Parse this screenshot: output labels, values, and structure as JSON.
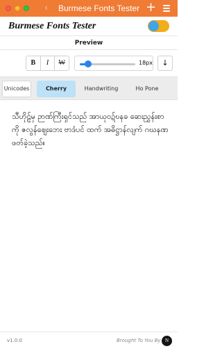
{
  "window": {
    "title": "Burmese Fonts Tester",
    "back_icon": "chevron-left-icon",
    "add_icon": "plus-icon",
    "menu_icon": "hamburger-menu-icon",
    "titlebar_color": "#ef7b35"
  },
  "header": {
    "app_title": "Burmese Fonts Tester",
    "toggle_on": true,
    "toggle_colors": {
      "track": "#f1ad1a",
      "knob": "#41a4e9"
    }
  },
  "preview_label": "Preview",
  "toolbar": {
    "bold_label": "B",
    "italic_label": "I",
    "strike_label": "W",
    "font_size": {
      "value": 18,
      "min": 12,
      "max": 72,
      "label": "18px"
    },
    "download_label": "↓",
    "accent": "#2a83e8"
  },
  "tabs": [
    {
      "label": "Unicodes",
      "active": false
    },
    {
      "label": "Cherry",
      "active": true
    },
    {
      "label": "Handwriting",
      "active": false
    },
    {
      "label": "Ho Pone",
      "active": false
    }
  ],
  "preview_text": "သီဟိုဠ်မှ ဉာဏ်ကြီးရှင်သည် အာယုဝဍ်ဎနခ ဆေးညွှန်းစာကို ဇလွန်ဈေးဘေး ဗာဒံပင် ထက် အဓိဋ္ဌာန်လျက် ဂဃနဏဖတ်ခဲ့သည်။",
  "footer": {
    "version": "v1.0.0",
    "brought_by": "Brought To You By",
    "logo_text": "N"
  }
}
